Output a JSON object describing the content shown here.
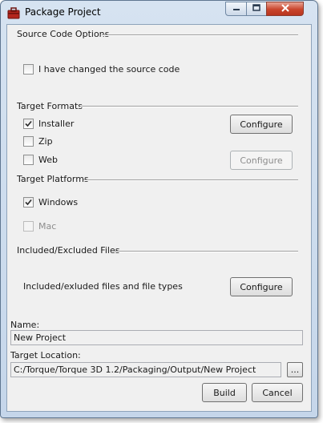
{
  "window": {
    "title": "Package Project",
    "close_color": "#c9452c"
  },
  "source_code": {
    "heading": "Source Code Options",
    "changed_label": "I have changed the source code",
    "changed_checked": false
  },
  "target_formats": {
    "heading": "Target Formats",
    "installer": {
      "label": "Installer",
      "checked": true,
      "configure_label": "Configure"
    },
    "zip": {
      "label": "Zip",
      "checked": false
    },
    "web": {
      "label": "Web",
      "checked": false,
      "configure_label": "Configure"
    }
  },
  "target_platforms": {
    "heading": "Target Platforms",
    "windows": {
      "label": "Windows",
      "checked": true
    },
    "mac": {
      "label": "Mac",
      "checked": false,
      "enabled": false
    }
  },
  "files": {
    "heading": "Included/Excluded Files",
    "description": "Included/exluded files and file types",
    "configure_label": "Configure"
  },
  "name": {
    "label": "Name:",
    "value": "New Project"
  },
  "location": {
    "label": "Target Location:",
    "value": "C:/Torque/Torque 3D 1.2/Packaging/Output/New Project",
    "browse_label": "..."
  },
  "actions": {
    "build_label": "Build",
    "cancel_label": "Cancel"
  }
}
